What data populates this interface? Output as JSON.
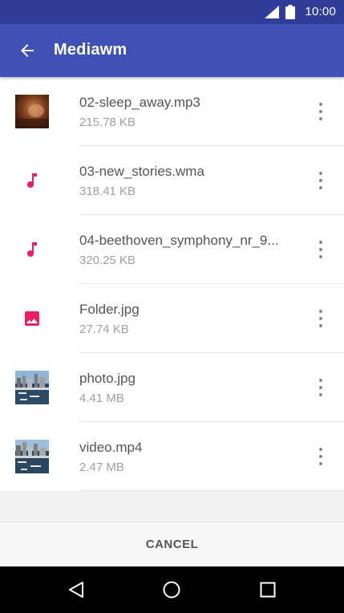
{
  "status_bar": {
    "time": "10:00",
    "icons": [
      "signal-icon",
      "battery-icon"
    ]
  },
  "app_bar": {
    "title": "Mediawm",
    "back_icon": "arrow-back-icon"
  },
  "files": [
    {
      "name": "02-sleep_away.mp3",
      "size": "215.78 KB",
      "icon": "album-art-thumbnail"
    },
    {
      "name": "03-new_stories.wma",
      "size": "318.41 KB",
      "icon": "music-note-icon"
    },
    {
      "name": "04-beethoven_symphony_nr_9...",
      "size": "320.25 KB",
      "icon": "music-note-icon"
    },
    {
      "name": "Folder.jpg",
      "size": "27.74 KB",
      "icon": "image-icon"
    },
    {
      "name": "photo.jpg",
      "size": "4.41 MB",
      "icon": "photo-thumbnail"
    },
    {
      "name": "video.mp4",
      "size": "2.47 MB",
      "icon": "video-thumbnail"
    }
  ],
  "dialog": {
    "cancel_label": "CANCEL"
  },
  "nav_bar": {
    "icons": [
      "back-triangle-icon",
      "home-circle-icon",
      "recents-square-icon"
    ]
  },
  "colors": {
    "primary": "#3f51b5",
    "primary_dark": "#2f3d99",
    "accent": "#e91e63"
  }
}
